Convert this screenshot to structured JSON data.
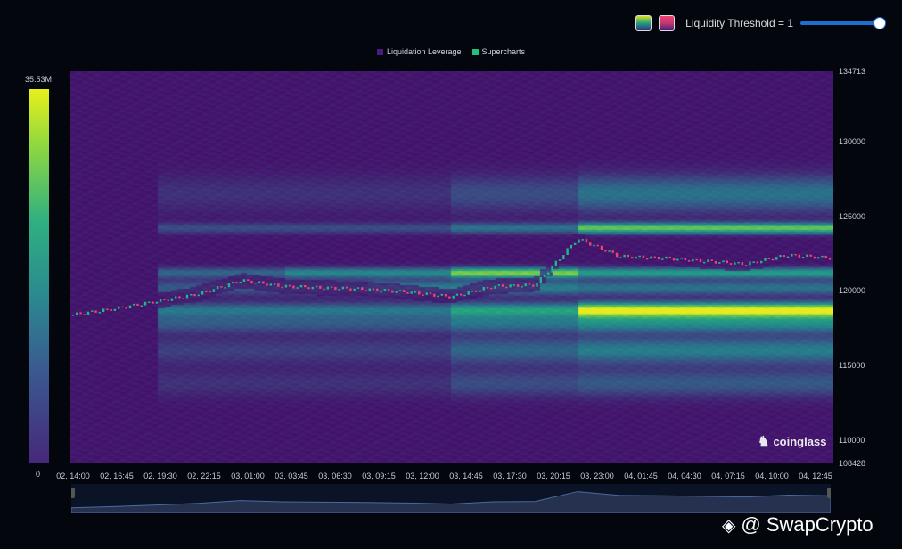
{
  "controls": {
    "threshold_label": "Liquidity Threshold = 1",
    "threshold_value": 1,
    "threshold_fraction": 1.0
  },
  "legend": [
    {
      "label": "Liquidation Leverage",
      "color": "#4a1a80"
    },
    {
      "label": "Supercharts",
      "color": "#22c07a"
    }
  ],
  "colorbar": {
    "max_label": "35.53M",
    "min_label": "0"
  },
  "logo": "coinglass",
  "watermark": "@ SwapCrypto",
  "chart_data": {
    "type": "heatmap",
    "title": "",
    "ylim": [
      108428,
      134713
    ],
    "y_ticks": [
      "134713",
      "130000",
      "125000",
      "120000",
      "115000",
      "110000",
      "108428"
    ],
    "y_tick_values": [
      134713,
      130000,
      125000,
      120000,
      115000,
      110000,
      108428
    ],
    "x_ticks": [
      "02, 14:00",
      "02, 16:45",
      "02, 19:30",
      "02, 22:15",
      "03, 01:00",
      "03, 03:45",
      "03, 06:30",
      "03, 09:15",
      "03, 12:00",
      "03, 14:45",
      "03, 17:30",
      "03, 20:15",
      "03, 23:00",
      "04, 01:45",
      "04, 04:30",
      "04, 07:15",
      "04, 10:00",
      "04, 12:45"
    ],
    "price": [
      118400,
      118800,
      119300,
      119800,
      120700,
      120300,
      120200,
      120100,
      119900,
      119600,
      120300,
      120400,
      123500,
      122300,
      122200,
      122000,
      121800,
      122400,
      122200
    ],
    "bands": [
      {
        "price": 118700,
        "width": 500,
        "intensity": [
          0.35,
          0.55,
          1.0
        ],
        "segments": [
          2,
          9,
          12
        ]
      },
      {
        "price": 124200,
        "width": 350,
        "intensity": [
          0.2,
          0.35,
          0.75
        ],
        "segments": [
          2,
          9,
          12
        ]
      },
      {
        "price": 121200,
        "width": 350,
        "intensity": [
          0.3,
          0.45,
          0.8,
          0.55
        ],
        "segments": [
          2,
          5,
          9,
          12
        ]
      },
      {
        "price": 120200,
        "width": 500,
        "intensity": [
          0.25,
          0.4,
          0.35
        ],
        "segments": [
          2,
          7,
          12
        ]
      },
      {
        "price": 117800,
        "width": 600,
        "intensity": [
          0.25,
          0.35,
          0.45
        ],
        "segments": [
          2,
          9,
          12
        ]
      },
      {
        "price": 116000,
        "width": 900,
        "intensity": [
          0.15,
          0.3,
          0.4
        ],
        "segments": [
          2,
          9,
          12
        ]
      },
      {
        "price": 126500,
        "width": 1200,
        "intensity": [
          0.1,
          0.2,
          0.35
        ],
        "segments": [
          2,
          9,
          12
        ]
      },
      {
        "price": 113800,
        "width": 900,
        "intensity": [
          0.1,
          0.2,
          0.25
        ],
        "segments": [
          2,
          9,
          12
        ]
      }
    ]
  }
}
